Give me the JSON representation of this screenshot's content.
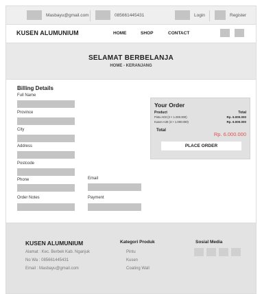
{
  "topbar": {
    "email": "Masbayu@gmail.com",
    "phone": "085661445431",
    "login": "Login",
    "register": "Register"
  },
  "navbar": {
    "brand": "KUSEN ALUMUNIUM",
    "links": [
      "HOME",
      "SHOP",
      "CONTACT"
    ]
  },
  "hero": {
    "title": "SELAMAT BERBELANJA",
    "breadcrumb": "HOME - KERANJANG"
  },
  "billing": {
    "title": "Billing Details",
    "fields": {
      "full_name": "Full Name",
      "province": "Province",
      "city": "City",
      "address": "Address",
      "postcode": "Postcode",
      "phone": "Phone",
      "email": "Email",
      "order_notes": "Order Notes",
      "payment": "Payment"
    }
  },
  "order": {
    "title": "Your Order",
    "col_product": "Product",
    "col_total": "Total",
    "items": [
      {
        "name": "Pintu A03 (3 × 1.000.000)",
        "total": "Rp. 6.000.000"
      },
      {
        "name": "Kusen A30 (3 × 1.000.000)",
        "total": "Rp. 6.000.000"
      }
    ],
    "total_label": "Total",
    "total_value": "Rp. 6.000.000",
    "place_order": "PLACE ORDER",
    "accent": "#e05050"
  },
  "footer": {
    "brand": "KUSEN ALUMUNIUM",
    "address": "Alamat : Kec. Berbek Kab. Nganjuk",
    "phone": "No Wa : 085661445431",
    "email": "Email   : Masbayu@gmail.com",
    "categories_title": "Kategori Produk",
    "categories": [
      "Pintu",
      "Kusen",
      "Coating Wall"
    ],
    "social_title": "Sosial Media"
  }
}
